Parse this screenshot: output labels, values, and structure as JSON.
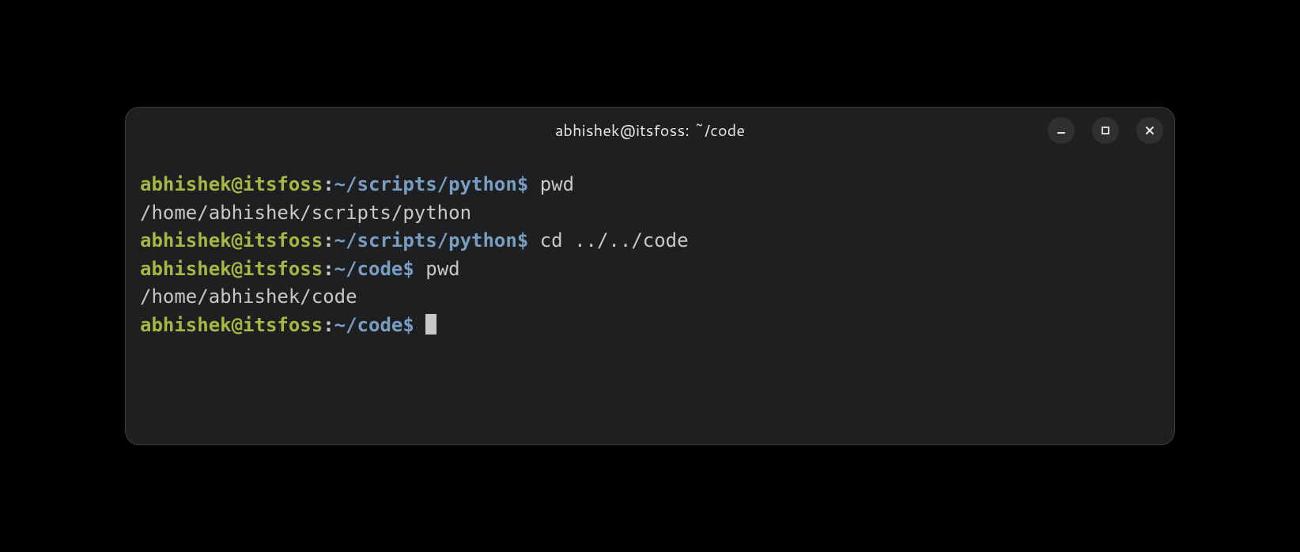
{
  "window": {
    "title": "abhishek@itsfoss: ~/code"
  },
  "prompt1": {
    "userhost": "abhishek@itsfoss",
    "path": "~/scripts/python",
    "symbol": "$",
    "command": "pwd"
  },
  "output1": "/home/abhishek/scripts/python",
  "prompt2": {
    "userhost": "abhishek@itsfoss",
    "path": "~/scripts/python",
    "symbol": "$",
    "command": "cd ../../code"
  },
  "prompt3": {
    "userhost": "abhishek@itsfoss",
    "path": "~/code",
    "symbol": "$",
    "command": "pwd"
  },
  "output2": "/home/abhishek/code",
  "prompt4": {
    "userhost": "abhishek@itsfoss",
    "path": "~/code",
    "symbol": "$",
    "command": ""
  }
}
